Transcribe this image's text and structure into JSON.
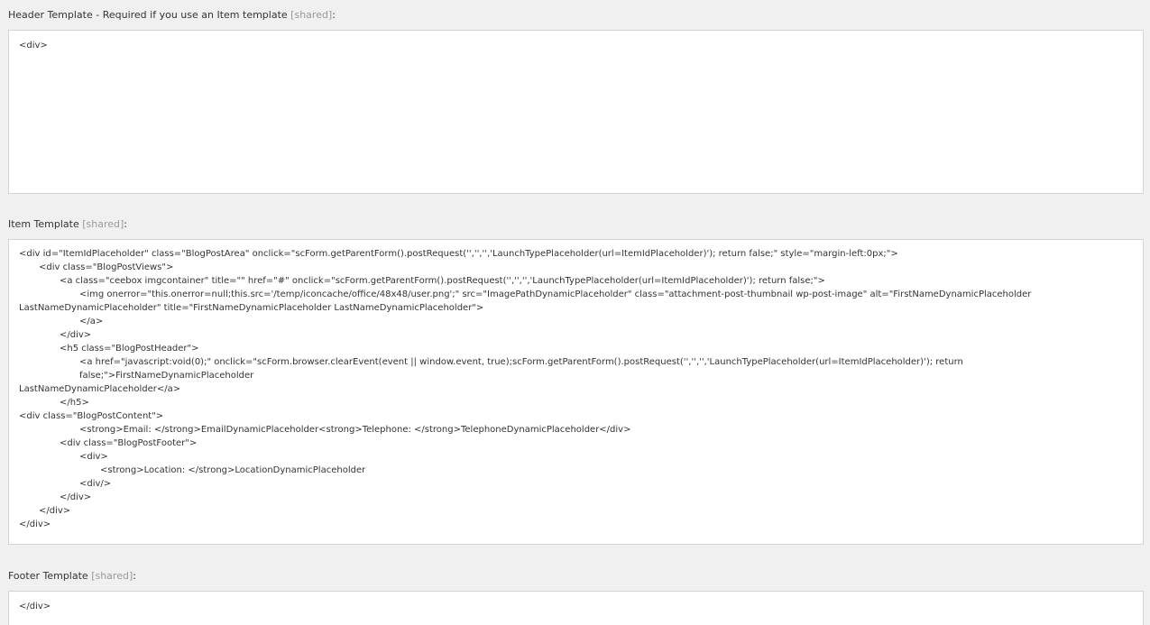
{
  "header_template": {
    "label": "Header Template - Required if you use an Item template",
    "shared_tag": "[shared]",
    "colon": ":",
    "value": "<div>"
  },
  "item_template": {
    "label": "Item Template",
    "shared_tag": "[shared]",
    "colon": ":",
    "lines": [
      "<div id=\"ItemIdPlaceholder\" class=\"BlogPostArea\" onclick=\"scForm.getParentForm().postRequest('','','','LaunchTypePlaceholder(url=ItemIdPlaceholder)'); return false;\" style=\"margin-left:0px;\">",
      "<div class=\"BlogPostViews\">",
      "<a class=\"ceebox imgcontainer\" title=\"\" href=\"#\" onclick=\"scForm.getParentForm().postRequest('','','','LaunchTypePlaceholder(url=ItemIdPlaceholder)'); return false;\">",
      "<img onerror=\"this.onerror=null;this.src='/temp/iconcache/office/48x48/user.png';\" src=\"ImagePathDynamicPlaceholder\" class=\"attachment-post-thumbnail wp-post-image\" alt=\"FirstNameDynamicPlaceholder",
      "LastNameDynamicPlaceholder\" title=\"FirstNameDynamicPlaceholder LastNameDynamicPlaceholder\">",
      "</a>",
      "</div>",
      "<h5 class=\"BlogPostHeader\">",
      "<a href=\"javascript:void(0);\" onclick=\"scForm.browser.clearEvent(event || window.event, true);scForm.getParentForm().postRequest('','','','LaunchTypePlaceholder(url=ItemIdPlaceholder)'); return false;\">FirstNameDynamicPlaceholder",
      "LastNameDynamicPlaceholder</a>",
      "</h5>",
      "<div class=\"BlogPostContent\">",
      "<strong>Email: </strong>EmailDynamicPlaceholder<strong>Telephone: </strong>TelephoneDynamicPlaceholder</div>",
      "<div class=\"BlogPostFooter\">",
      "<div>",
      "<strong>Location: </strong>LocationDynamicPlaceholder",
      "<div/>",
      "</div>",
      "</div>",
      "</div>"
    ]
  },
  "footer_template": {
    "label": "Footer Template",
    "shared_tag": "[shared]",
    "colon": ":",
    "value": "</div>"
  }
}
